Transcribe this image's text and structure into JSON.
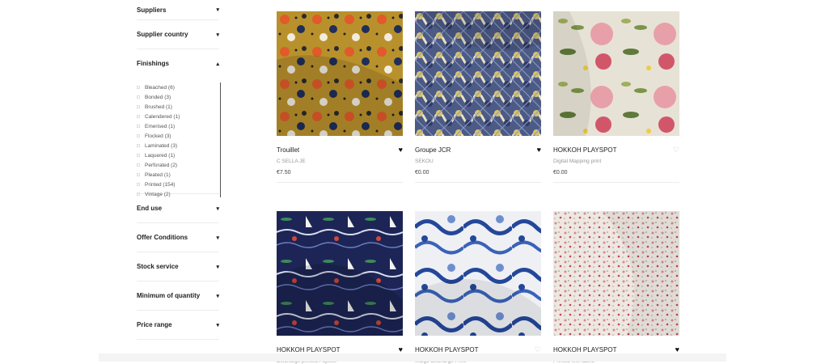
{
  "sidebar": {
    "filters_top": [
      {
        "label": "Suppliers",
        "chevron": "▾"
      },
      {
        "label": "Supplier country",
        "chevron": "▾"
      }
    ],
    "finishings": {
      "label": "Finishings",
      "chevron": "▴",
      "options": [
        "Bleached (6)",
        "Bonded (3)",
        "Brushed (1)",
        "Calendered (1)",
        "Emerised (1)",
        "Flocked (3)",
        "Laminated (3)",
        "Laquered (1)",
        "Perforated (2)",
        "Pleated (1)",
        "Printed (154)",
        "Vintage (2)"
      ]
    },
    "filters_bottom": [
      {
        "label": "End use",
        "chevron": "▾"
      },
      {
        "label": "Offer Conditions",
        "chevron": "▾"
      },
      {
        "label": "Stock service",
        "chevron": "▾"
      },
      {
        "label": "Minimum of quantity",
        "chevron": "▾"
      },
      {
        "label": "Price range",
        "chevron": "▾"
      }
    ]
  },
  "products": [
    {
      "name": "Trouillet",
      "supplier": "C SELLA JE",
      "price": "€7.50",
      "liked": true,
      "heart": "♥"
    },
    {
      "name": "Groupe JCR",
      "supplier": "SEKOU",
      "price": "€0.00",
      "liked": true,
      "heart": "♥"
    },
    {
      "name": "HOKKOH PLAYSPOT",
      "supplier": "Digital Mapping print",
      "price": "€0.00",
      "liked": false,
      "heart": "♡"
    },
    {
      "name": "HOKKOH PLAYSPOT",
      "supplier": "Discharge printed Fujiette",
      "price": "",
      "liked": true,
      "heart": "♥"
    },
    {
      "name": "HOKKOH PLAYSPOT",
      "supplier": "Indigo discharge Print",
      "price": "",
      "liked": false,
      "heart": "♡"
    },
    {
      "name": "HOKKOH PLAYSPOT",
      "supplier": "Printed fine fabric",
      "price": "",
      "liked": true,
      "heart": "♥"
    }
  ]
}
